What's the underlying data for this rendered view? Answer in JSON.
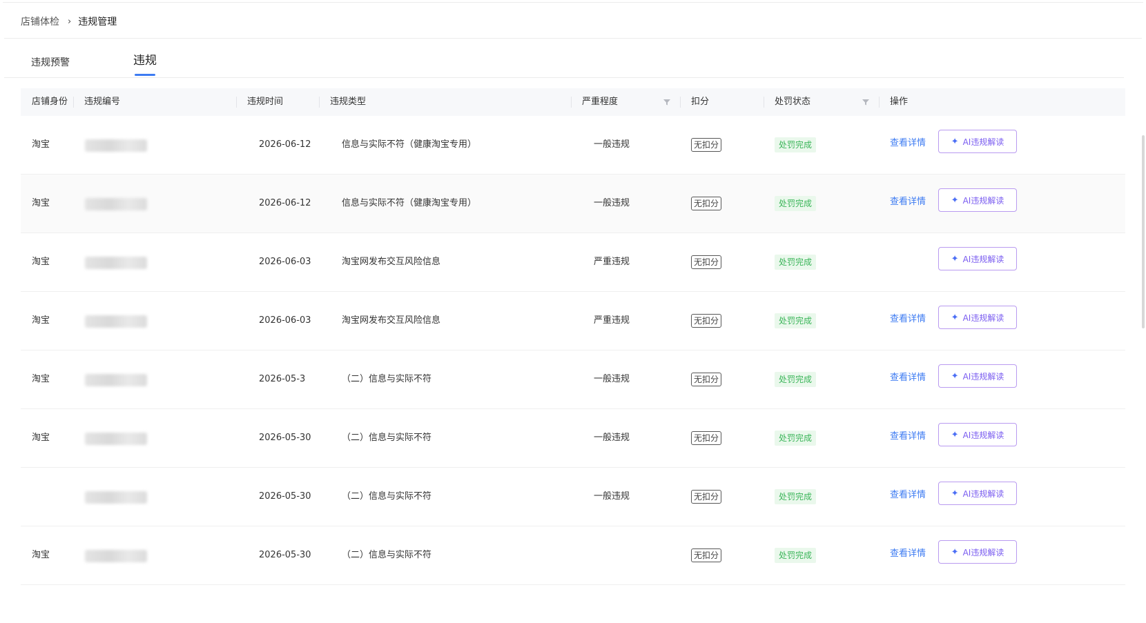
{
  "breadcrumb": {
    "parent": "店铺体检",
    "separator": "›",
    "current": "违规管理"
  },
  "tabs": [
    {
      "label": "违规预警",
      "active": false
    },
    {
      "label": "违规",
      "active": true
    }
  ],
  "table": {
    "headers": {
      "shop_identity": "店铺身份",
      "violation_id": "违规编号",
      "violation_time": "违规时间",
      "violation_type": "违规类型",
      "severity": "严重程度",
      "points": "扣分",
      "penalty_status": "处罚状态",
      "actions": "操作"
    },
    "rows": [
      {
        "shop": "淘宝",
        "date": "2026-06-12",
        "type": "信息与实际不符（健康淘宝专用）",
        "severity": "一般违规",
        "points": "无扣分",
        "status": "处罚完成",
        "detail": "查看详情",
        "ai": "AI违规解读"
      },
      {
        "shop": "淘宝",
        "date": "2026-06-12",
        "type": "信息与实际不符（健康淘宝专用）",
        "severity": "一般违规",
        "points": "无扣分",
        "status": "处罚完成",
        "detail": "查看详情",
        "ai": "AI违规解读"
      },
      {
        "shop": "淘宝",
        "date": "2026-06-03",
        "type": "淘宝网发布交互风险信息",
        "severity": "严重违规",
        "points": "无扣分",
        "status": "处罚完成",
        "detail": "",
        "ai": "AI违规解读"
      },
      {
        "shop": "淘宝",
        "date": "2026-06-03",
        "type": "淘宝网发布交互风险信息",
        "severity": "严重违规",
        "points": "无扣分",
        "status": "处罚完成",
        "detail": "查看详情",
        "ai": "AI违规解读"
      },
      {
        "shop": "淘宝",
        "date": "2026-05-3",
        "type": "（二）信息与实际不符",
        "severity": "一般违规",
        "points": "无扣分",
        "status": "处罚完成",
        "detail": "查看详情",
        "ai": "AI违规解读"
      },
      {
        "shop": "淘宝",
        "date": "2026-05-30",
        "type": "（二）信息与实际不符",
        "severity": "一般违规",
        "points": "无扣分",
        "status": "处罚完成",
        "detail": "查看详情",
        "ai": "AI违规解读"
      },
      {
        "shop": "",
        "date": "2026-05-30",
        "type": "（二）信息与实际不符",
        "severity": "一般违规",
        "points": "无扣分",
        "status": "处罚完成",
        "detail": "查看详情",
        "ai": "AI违规解读"
      },
      {
        "shop": "淘宝",
        "date": "2026-05-30",
        "type": "（二）信息与实际不符",
        "severity": "",
        "points": "无扣分",
        "status": "处罚完成",
        "detail": "查看详情",
        "ai": "AI违规解读"
      }
    ]
  },
  "icons": {
    "breadcrumb_separator": "chevron-right-icon",
    "filter": "filter-icon",
    "ai": "sparkle-icon"
  },
  "colors": {
    "primary": "#3d7bf2",
    "success_text": "#3bb559",
    "success_bg": "#eaf8ec",
    "ai_border": "#b99af0",
    "ai_text": "#7a5cf0"
  }
}
